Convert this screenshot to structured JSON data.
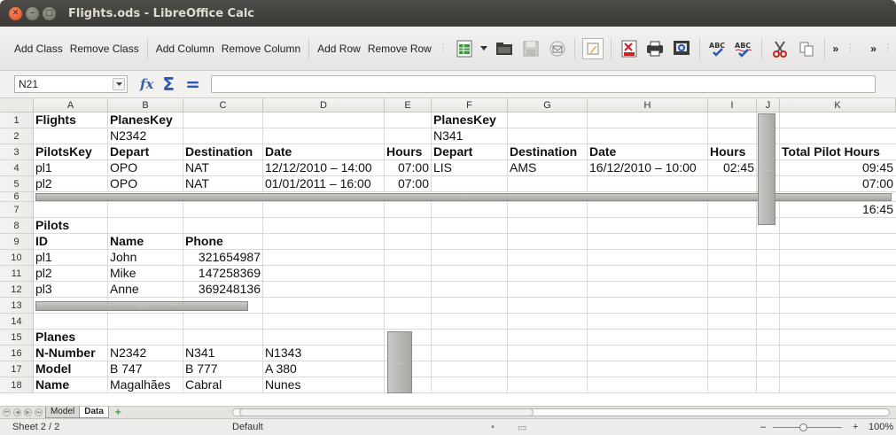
{
  "window": {
    "title": "Flights.ods - LibreOffice Calc",
    "close_glyph": "✕",
    "min_glyph": "–",
    "max_glyph": "□"
  },
  "toolbar": {
    "items": [
      "Add Class",
      "Remove Class",
      "Add Column",
      "Remove Column",
      "Add Row",
      "Remove Row"
    ],
    "more_glyph": "»",
    "grip_glyph": "⋮"
  },
  "formula": {
    "cell_ref": "N21",
    "fx_glyph": "fx",
    "sum_glyph": "Σ",
    "equals_glyph": "="
  },
  "grid": {
    "columns": [
      "A",
      "B",
      "C",
      "D",
      "E",
      "F",
      "G",
      "H",
      "I",
      "J",
      "K"
    ],
    "rows": [
      "1",
      "2",
      "3",
      "4",
      "5",
      "6",
      "7",
      "8",
      "9",
      "10",
      "11",
      "12",
      "13",
      "14",
      "15",
      "16",
      "17",
      "18"
    ],
    "group_glyph": "⋮",
    "group_glyph_ellipsis": "...",
    "cells": {
      "A1": "Flights",
      "B1": "PlanesKey",
      "F1": "PlanesKey",
      "B2": "N2342",
      "F2": "N341",
      "A3": "PilotsKey",
      "B3": "Depart",
      "C3": "Destination",
      "D3": "Date",
      "E3": "Hours",
      "F3": "Depart",
      "G3": "Destination",
      "H3": "Date",
      "I3": "Hours",
      "K3": "Total Pilot Hours",
      "A4": "pl1",
      "B4": "OPO",
      "C4": "NAT",
      "D4": "12/12/2010 – 14:00",
      "E4": "07:00",
      "F4": "LIS",
      "G4": "AMS",
      "H4": "16/12/2010 – 10:00",
      "I4": "02:45",
      "K4": "09:45",
      "A5": "pl2",
      "B5": "OPO",
      "C5": "NAT",
      "D5": "01/01/2011 – 16:00",
      "E5": "07:00",
      "K5": "07:00",
      "K7": "16:45",
      "A8": "Pilots",
      "A9": "ID",
      "B9": "Name",
      "C9": "Phone",
      "A10": "pl1",
      "B10": "John",
      "C10": "321654987",
      "A11": "pl2",
      "B11": "Mike",
      "C11": "147258369",
      "A12": "pl3",
      "B12": "Anne",
      "C12": "369248136",
      "A15": "Planes",
      "A16": "N-Number",
      "B16": "N2342",
      "C16": "N341",
      "D16": "N1343",
      "A17": "Model",
      "B17": "B 747",
      "C17": "B 777",
      "D17": "A 380",
      "A18": "Name",
      "B18": "Magalhães",
      "C18": "Cabral",
      "D18": "Nunes"
    }
  },
  "sheets": {
    "tabs": [
      "Model",
      "Data"
    ],
    "active": "Data",
    "add_glyph": "+"
  },
  "status": {
    "sheet": "Sheet 2 / 2",
    "style": "Default",
    "zoom": "100%",
    "zoom_minus": "–",
    "zoom_plus": "+"
  }
}
